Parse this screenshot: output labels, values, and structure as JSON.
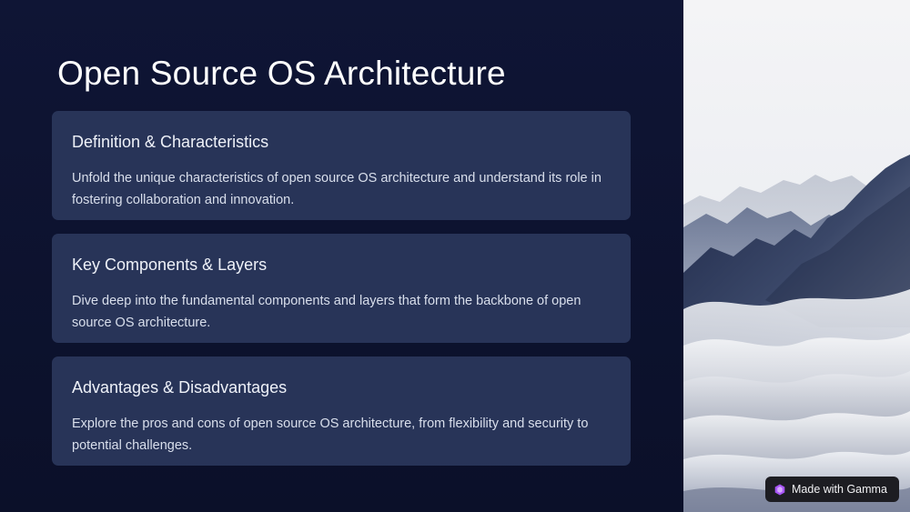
{
  "slide": {
    "title": "Open Source OS Architecture",
    "cards": [
      {
        "heading": "Definition & Characteristics",
        "body": "Unfold the unique characteristics of open source OS architecture and understand its role in fostering collaboration and innovation."
      },
      {
        "heading": "Key Components & Layers",
        "body": "Dive deep into the fundamental components and layers that form the backbone of open source OS architecture."
      },
      {
        "heading": "Advantages & Disadvantages",
        "body": "Explore the pros and cons of open source OS architecture, from flexibility and security to potential challenges."
      }
    ]
  },
  "image": {
    "icon": "mountain-landscape-image"
  },
  "badge": {
    "label": "Made with Gamma",
    "icon": "gamma-logo-icon"
  },
  "colors": {
    "background": "#0f1535",
    "card": "#283458",
    "title_text": "#ffffff",
    "body_text": "#d9dfec",
    "badge_bg": "#1d1d22",
    "badge_icon": "#a855f7"
  }
}
